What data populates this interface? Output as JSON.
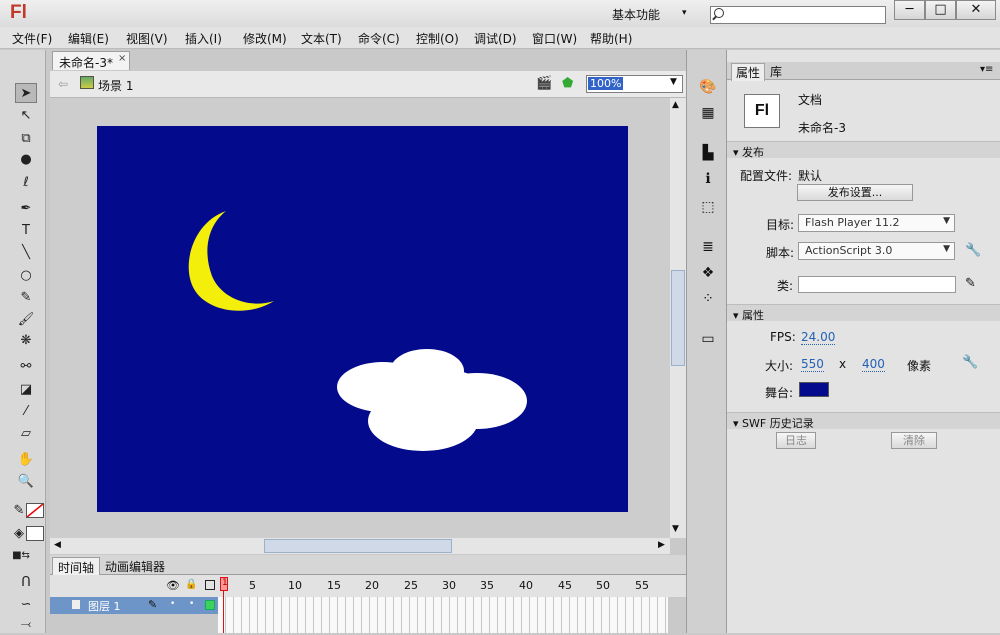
{
  "app": {
    "logo": "Fl",
    "workspace": "基本功能",
    "window_buttons": [
      "─",
      "□",
      "✕"
    ]
  },
  "menubar": [
    "文件(F)",
    "编辑(E)",
    "视图(V)",
    "插入(I)",
    "修改(M)",
    "文本(T)",
    "命令(C)",
    "控制(O)",
    "调试(D)",
    "窗口(W)",
    "帮助(H)"
  ],
  "document": {
    "tab": "未命名-3*",
    "close": "×",
    "scene": "场景 1",
    "zoom": "100%"
  },
  "colors": {
    "stage": "#030a8b",
    "moon": "#f4ef0a",
    "cloud": "#ffffff",
    "stroke": "#ff0000",
    "fill": "#ffffff"
  },
  "timeline": {
    "tabs": [
      "时间轴",
      "动画编辑器"
    ],
    "frame_numbers": [
      "1",
      "5",
      "10",
      "15",
      "20",
      "25",
      "30",
      "35",
      "40",
      "45",
      "50",
      "55"
    ],
    "layer": "图层 1"
  },
  "properties": {
    "tabs": [
      "属性",
      "库"
    ],
    "doc_type": "文档",
    "doc_name": "未命名-3",
    "doc_icon": "Fl",
    "publish": {
      "header": "发布",
      "profile_label": "配置文件:",
      "profile_value": "默认",
      "settings_button": "发布设置...",
      "target_label": "目标:",
      "target": "Flash Player 11.2",
      "script_label": "脚本:",
      "script": "ActionScript 3.0",
      "class_label": "类:"
    },
    "properties": {
      "header": "属性",
      "fps_label": "FPS:",
      "fps": "24.00",
      "size_label": "大小:",
      "width": "550",
      "x": "x",
      "height": "400",
      "unit": "像素",
      "stage_label": "舞台:"
    },
    "swf": {
      "header": "SWF 历史记录",
      "log_button": "日志",
      "clear_button": "清除"
    }
  }
}
